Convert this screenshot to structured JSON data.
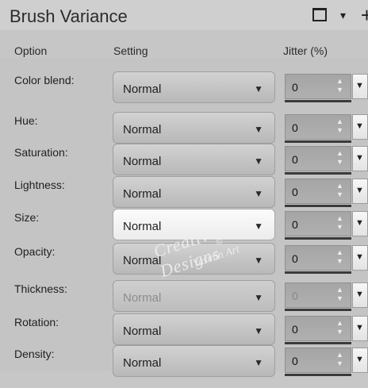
{
  "header": {
    "title": "Brush Variance",
    "icons": [
      "window-square-icon",
      "chevron-down-icon",
      "plus-icon"
    ]
  },
  "columns": {
    "option": "Option",
    "setting": "Setting",
    "jitter": "Jitter (%)"
  },
  "rows": [
    {
      "label": "Color blend:",
      "setting": "Normal",
      "jitter": "0"
    },
    {
      "label": "Hue:",
      "setting": "Normal",
      "jitter": "0"
    },
    {
      "label": "Saturation:",
      "setting": "Normal",
      "jitter": "0"
    },
    {
      "label": "Lightness:",
      "setting": "Normal",
      "jitter": "0"
    },
    {
      "label": "Size:",
      "setting": "Normal",
      "jitter": "0"
    },
    {
      "label": "Opacity:",
      "setting": "Normal",
      "jitter": "0"
    },
    {
      "label": "Thickness:",
      "setting": "Normal",
      "jitter": "0"
    },
    {
      "label": "Rotation:",
      "setting": "Normal",
      "jitter": "0"
    },
    {
      "label": "Density:",
      "setting": "Normal",
      "jitter": "0"
    }
  ],
  "watermark": {
    "line1": "Creative-Designs",
    "line2": "Yasmin Art",
    "mark": "©"
  }
}
